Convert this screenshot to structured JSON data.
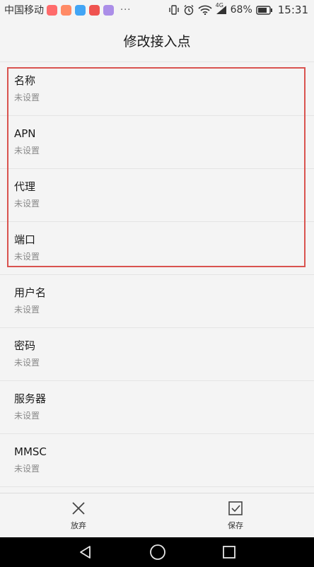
{
  "status_bar": {
    "carrier": "中国移动",
    "dots": "···",
    "network": "4G",
    "battery_percent": "68%",
    "time": "15:31",
    "app_icon_colors": [
      "#ff6b6b",
      "#ff8a65",
      "#42a5f5",
      "#ef5350",
      "#ab8ee8"
    ]
  },
  "header": {
    "title": "修改接入点"
  },
  "rows": [
    {
      "label": "名称",
      "value": "未设置"
    },
    {
      "label": "APN",
      "value": "未设置"
    },
    {
      "label": "代理",
      "value": "未设置"
    },
    {
      "label": "端口",
      "value": "未设置"
    },
    {
      "label": "用户名",
      "value": "未设置"
    },
    {
      "label": "密码",
      "value": "未设置"
    },
    {
      "label": "服务器",
      "value": "未设置"
    },
    {
      "label": "MMSC",
      "value": "未设置"
    }
  ],
  "bottom_bar": {
    "discard_label": "放弃",
    "save_label": "保存"
  },
  "icons": {
    "discard": "close-icon",
    "save": "checkbox-icon",
    "nav_back": "triangle-back-icon",
    "nav_home": "circle-home-icon",
    "nav_recent": "square-recent-icon"
  },
  "colors": {
    "highlight_border": "#d9534f",
    "background": "#f4f4f4"
  }
}
